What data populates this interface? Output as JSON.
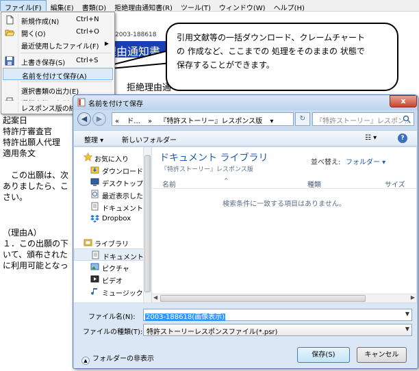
{
  "menubar": {
    "items": [
      "ファイル(F)",
      "編集(E)",
      "書類(D)",
      "拒絶理由通知書(R)",
      "ツール(T)",
      "ウィンドウ(W)",
      "ヘルプ(H)"
    ]
  },
  "document": {
    "header_number": "特願2003-188618",
    "title": "理由通知書",
    "title_line2": "『特願2",
    "subtitle": "拒絶理由通",
    "body_lines": [
      "起案日",
      "特許庁審査官",
      "特許出願人代理",
      "適用条文",
      "",
      "　この出願は、次",
      "ありましたら、こ",
      "さい。"
    ],
    "bottom_lines": [
      "（理由A）",
      "１．この出願の下",
      "いて、頒布された",
      "に利用可能となっ"
    ]
  },
  "file_menu": {
    "items": [
      {
        "label": "新規作成(N)",
        "shortcut": "Ctrl+N",
        "icon": "new-document-icon"
      },
      {
        "label": "開く(O)",
        "shortcut": "Ctrl+O",
        "icon": "open-folder-icon"
      },
      {
        "label": "最近使用したファイル(F)",
        "shortcut": "",
        "icon": "",
        "submenu": true
      },
      {
        "label": "上書き保存(S)",
        "shortcut": "Ctrl+S",
        "icon": "save-disk-icon"
      },
      {
        "label": "名前を付けて保存(A)",
        "shortcut": "",
        "icon": "",
        "highlighted": true
      },
      {
        "label": "選択書類の出力(E)",
        "shortcut": "",
        "icon": ""
      },
      {
        "label": "選択書類の印刷(P)",
        "shortcut": "",
        "icon": "printer-icon"
      },
      {
        "label": "レスポンス版の終",
        "shortcut": "",
        "icon": ""
      }
    ]
  },
  "callout": {
    "lines": [
      "引用文献等の一括ダウンロード、クレームチャート",
      "の 作成など、ここまでの 処理をそのままの 状態で",
      "保存することができます。"
    ]
  },
  "dialog": {
    "title": "名前を付けて保存",
    "close_label": "x",
    "address": {
      "crumbs": [
        "«",
        "ド...",
        "»",
        "『特許ストーリー』レスポンス版",
        "▾"
      ],
      "search_placeholder": "『特許ストーリー』レスポン..."
    },
    "toolbar": {
      "organize": "整理 ▾",
      "new_folder": "新しいフォルダー",
      "view": "☷ ▾",
      "help": "?"
    },
    "nav": {
      "items": [
        {
          "label": "お気に入り",
          "icon": "star-icon",
          "indent": 0
        },
        {
          "label": "ダウンロード",
          "icon": "download-folder-icon",
          "indent": 1
        },
        {
          "label": "デスクトップ",
          "icon": "desktop-icon",
          "indent": 1
        },
        {
          "label": "最近表示した場所",
          "icon": "recent-places-icon",
          "indent": 1
        },
        {
          "label": "ドキュメント",
          "icon": "document-icon",
          "indent": 1
        },
        {
          "label": "Dropbox",
          "icon": "dropbox-icon",
          "indent": 1
        },
        {
          "label": "",
          "icon": "",
          "indent": 1
        },
        {
          "label": "ライブラリ",
          "icon": "library-icon",
          "indent": 0
        },
        {
          "label": "ドキュメント",
          "icon": "document-icon",
          "indent": 1,
          "selected": true
        },
        {
          "label": "ピクチャ",
          "icon": "pictures-icon",
          "indent": 1
        },
        {
          "label": "ビデオ",
          "icon": "video-icon",
          "indent": 1
        },
        {
          "label": "ミュージック",
          "icon": "music-icon",
          "indent": 1
        }
      ]
    },
    "library": {
      "title": "ドキュメント ライブラリ",
      "subtitle": "『特許ストーリー』レスポンス版",
      "sort_label": "並べ替え:",
      "sort_value": "フォルダー ▾",
      "columns": [
        "名前",
        "種類",
        "サイズ"
      ],
      "empty_message": "検索条件に一致する項目はありません。"
    },
    "form": {
      "filename_label": "ファイル名(N):",
      "filename_value": "2003-188618(画像表示)",
      "filetype_label": "ファイルの種類(T):",
      "filetype_value": "特許ストーリーレスポンスファイル(*.psr)",
      "hide_folders": "フォルダーの非表示",
      "save_button": "保存(S)",
      "cancel_button": "キャンセル"
    }
  },
  "colors": {
    "doc_title_bg": "#1a3fb4",
    "library_title": "#1e5aa8",
    "menu_highlight": "#dcebfa",
    "close_button": "#c7452e"
  }
}
